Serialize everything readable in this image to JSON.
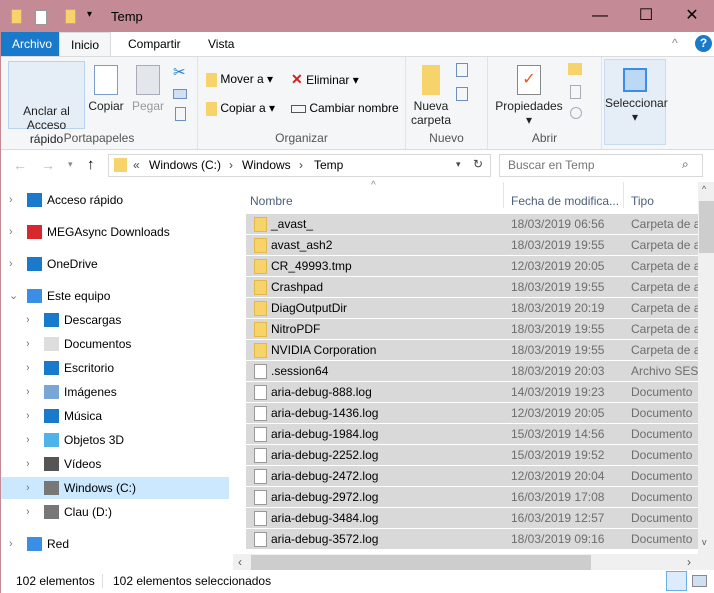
{
  "window": {
    "title": "Temp",
    "minimize": "—",
    "maximize": "☐",
    "close": "✕"
  },
  "tabs": [
    "Archivo",
    "Inicio",
    "Compartir",
    "Vista"
  ],
  "ribbon": {
    "portapapeles": {
      "label": "Portapapeles",
      "pin": "Anclar al Acceso rápido",
      "copy": "Copiar",
      "paste": "Pegar"
    },
    "organizar": {
      "label": "Organizar",
      "move": "Mover a",
      "copy_to": "Copiar a",
      "delete": "Eliminar",
      "rename": "Cambiar nombre"
    },
    "nuevo": {
      "label": "Nuevo",
      "new_folder": "Nueva carpeta"
    },
    "abrir": {
      "label": "Abrir",
      "properties": "Propiedades"
    },
    "select": "Seleccionar"
  },
  "address": {
    "crumbs": [
      "«",
      "Windows (C:)",
      "Temp"
    ],
    "search_placeholder": "Buscar en Temp"
  },
  "sidebar": [
    {
      "label": "Acceso rápido",
      "icon": "star-icon",
      "indent": 0
    },
    {
      "label": "MEGAsync Downloads",
      "icon": "mega-icon",
      "indent": 0
    },
    {
      "label": "OneDrive",
      "icon": "cloud-icon",
      "indent": 0
    },
    {
      "label": "Este equipo",
      "icon": "computer-icon",
      "indent": 0,
      "expanded": true
    },
    {
      "label": "Descargas",
      "icon": "download-icon",
      "indent": 1
    },
    {
      "label": "Documentos",
      "icon": "document-icon",
      "indent": 1
    },
    {
      "label": "Escritorio",
      "icon": "desktop-icon",
      "indent": 1
    },
    {
      "label": "Imágenes",
      "icon": "image-icon",
      "indent": 1
    },
    {
      "label": "Música",
      "icon": "music-icon",
      "indent": 1
    },
    {
      "label": "Objetos 3D",
      "icon": "cube-icon",
      "indent": 1
    },
    {
      "label": "Vídeos",
      "icon": "video-icon",
      "indent": 1
    },
    {
      "label": "Windows (C:)",
      "icon": "drive-icon",
      "indent": 1,
      "selected": true
    },
    {
      "label": "Clau (D:)",
      "icon": "drive-icon",
      "indent": 1
    },
    {
      "label": "Red",
      "icon": "network-icon",
      "indent": 0
    }
  ],
  "columns": [
    "Nombre",
    "Fecha de modifica...",
    "Tipo"
  ],
  "files": [
    {
      "name": "_avast_",
      "date": "18/03/2019 06:56",
      "type": "Carpeta de a",
      "folder": true
    },
    {
      "name": "avast_ash2",
      "date": "18/03/2019 19:55",
      "type": "Carpeta de a",
      "folder": true
    },
    {
      "name": "CR_49993.tmp",
      "date": "12/03/2019 20:05",
      "type": "Carpeta de a",
      "folder": true
    },
    {
      "name": "Crashpad",
      "date": "18/03/2019 19:55",
      "type": "Carpeta de a",
      "folder": true
    },
    {
      "name": "DiagOutputDir",
      "date": "18/03/2019 20:19",
      "type": "Carpeta de a",
      "folder": true
    },
    {
      "name": "NitroPDF",
      "date": "18/03/2019 19:55",
      "type": "Carpeta de a",
      "folder": true
    },
    {
      "name": "NVIDIA Corporation",
      "date": "18/03/2019 19:55",
      "type": "Carpeta de a",
      "folder": true
    },
    {
      "name": ".session64",
      "date": "18/03/2019 20:03",
      "type": "Archivo SESS",
      "folder": false
    },
    {
      "name": "aria-debug-888.log",
      "date": "14/03/2019 19:23",
      "type": "Documento",
      "folder": false
    },
    {
      "name": "aria-debug-1436.log",
      "date": "12/03/2019 20:05",
      "type": "Documento",
      "folder": false
    },
    {
      "name": "aria-debug-1984.log",
      "date": "15/03/2019 14:56",
      "type": "Documento",
      "folder": false
    },
    {
      "name": "aria-debug-2252.log",
      "date": "15/03/2019 19:52",
      "type": "Documento",
      "folder": false
    },
    {
      "name": "aria-debug-2472.log",
      "date": "12/03/2019 20:04",
      "type": "Documento",
      "folder": false
    },
    {
      "name": "aria-debug-2972.log",
      "date": "16/03/2019 17:08",
      "type": "Documento",
      "folder": false
    },
    {
      "name": "aria-debug-3484.log",
      "date": "16/03/2019 12:57",
      "type": "Documento",
      "folder": false
    },
    {
      "name": "aria-debug-3572.log",
      "date": "18/03/2019 09:16",
      "type": "Documento",
      "folder": false
    }
  ],
  "status": {
    "count": "102 elementos",
    "selected": "102 elementos seleccionados"
  }
}
